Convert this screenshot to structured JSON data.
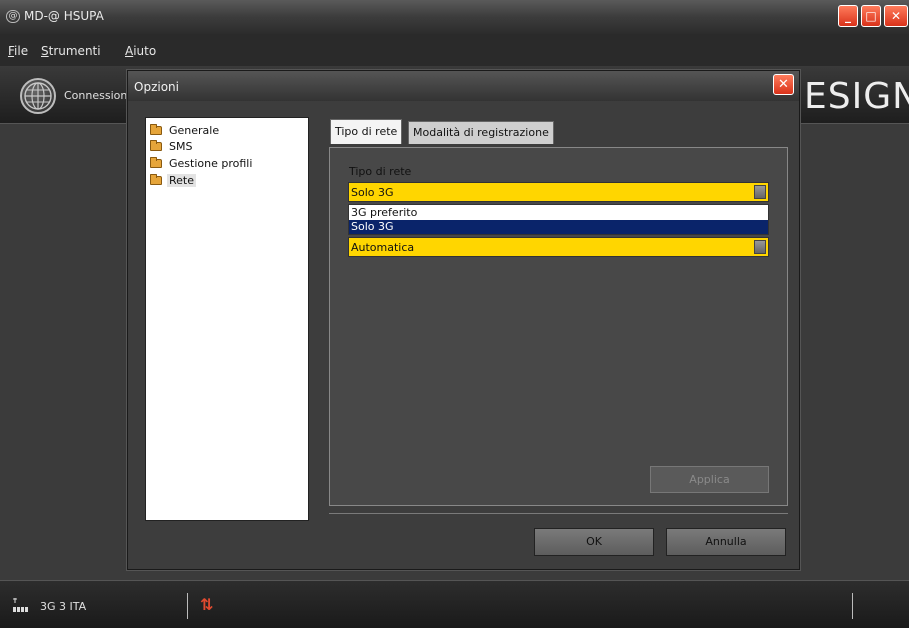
{
  "app": {
    "title": "MD-@ HSUPA",
    "icon_glyph": "@",
    "brand_text": "ESIGN",
    "window_controls": [
      "_",
      "□",
      "✕"
    ],
    "accent_color": "#e04a2f"
  },
  "menu": {
    "file": {
      "hotkey": "F",
      "rest": "ile"
    },
    "tools": {
      "hotkey": "S",
      "rest": "trumenti"
    },
    "help": {
      "hotkey": "A",
      "rest": "iuto"
    }
  },
  "toolbar": {
    "connect_label": "Connession"
  },
  "dialog": {
    "title": "Opzioni",
    "close_glyph": "✕",
    "tree": [
      {
        "label": "Generale",
        "icon": "folder-icon"
      },
      {
        "label": "SMS",
        "icon": "folder-icon"
      },
      {
        "label": "Gestione profili",
        "icon": "folder-icon"
      },
      {
        "label": "Rete",
        "icon": "folder-open-icon",
        "selected": true
      }
    ],
    "tabs": [
      {
        "label": "Tipo di rete",
        "active": true
      },
      {
        "label": "Modalità di registrazione",
        "active": false
      }
    ],
    "field_label": "Tipo di rete",
    "network_select": {
      "value": "Solo 3G"
    },
    "dropdown_options": [
      {
        "label": "3G preferito",
        "selected": false
      },
      {
        "label": "Solo 3G",
        "selected": true
      }
    ],
    "mode_select": {
      "value": "Automatica"
    },
    "apply_label": "Applica",
    "ok_label": "OK",
    "cancel_label": "Annulla"
  },
  "statusbar": {
    "network": "3G 3 ITA",
    "traffic_icon": "up-down-arrows-icon"
  }
}
